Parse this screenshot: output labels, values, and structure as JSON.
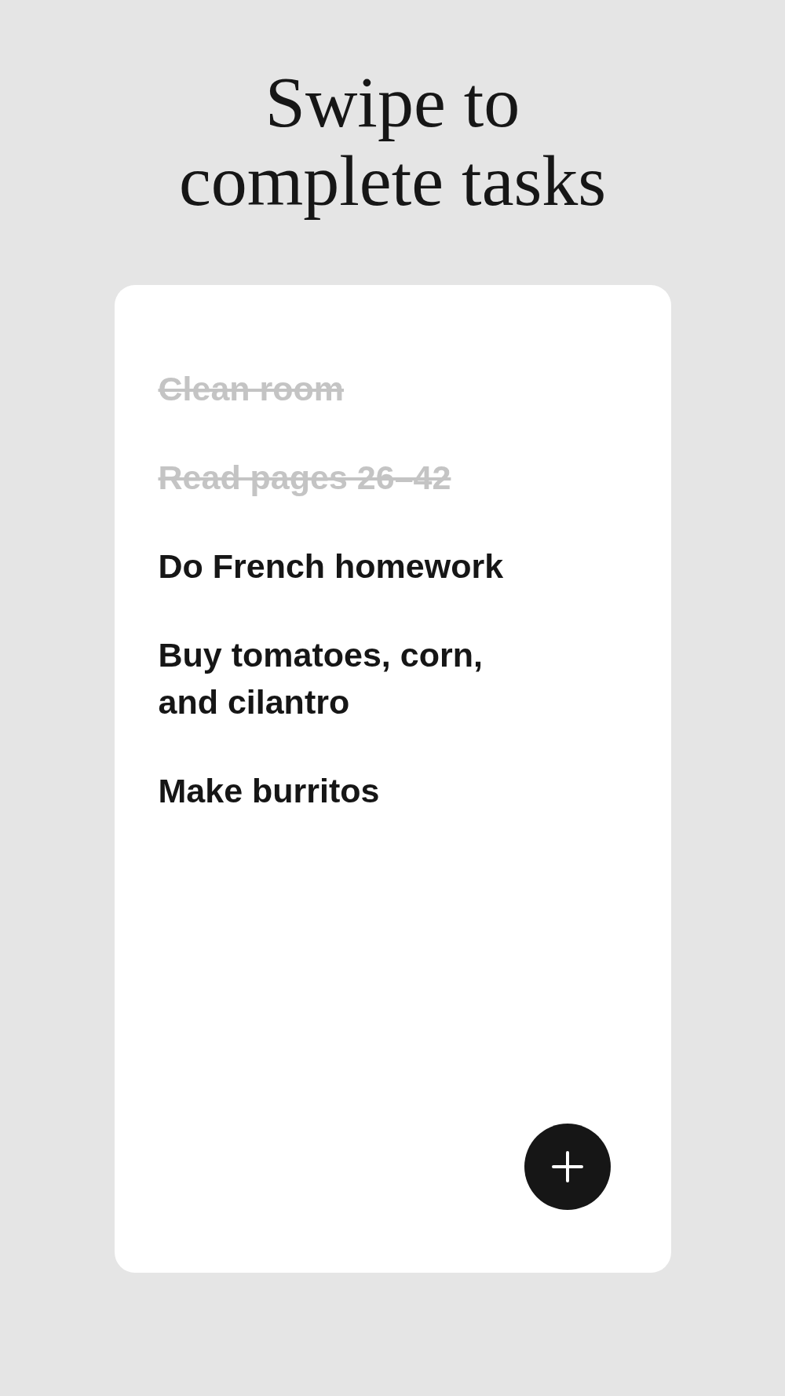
{
  "title": "Swipe to complete tasks",
  "tasks": [
    {
      "text": "Clean room",
      "done": true
    },
    {
      "text": "Read pages 26–42",
      "done": true
    },
    {
      "text": "Do French homework",
      "done": false
    },
    {
      "text": "Buy tomatoes, corn, and cilantro",
      "done": false
    },
    {
      "text": "Make burritos",
      "done": false
    }
  ]
}
